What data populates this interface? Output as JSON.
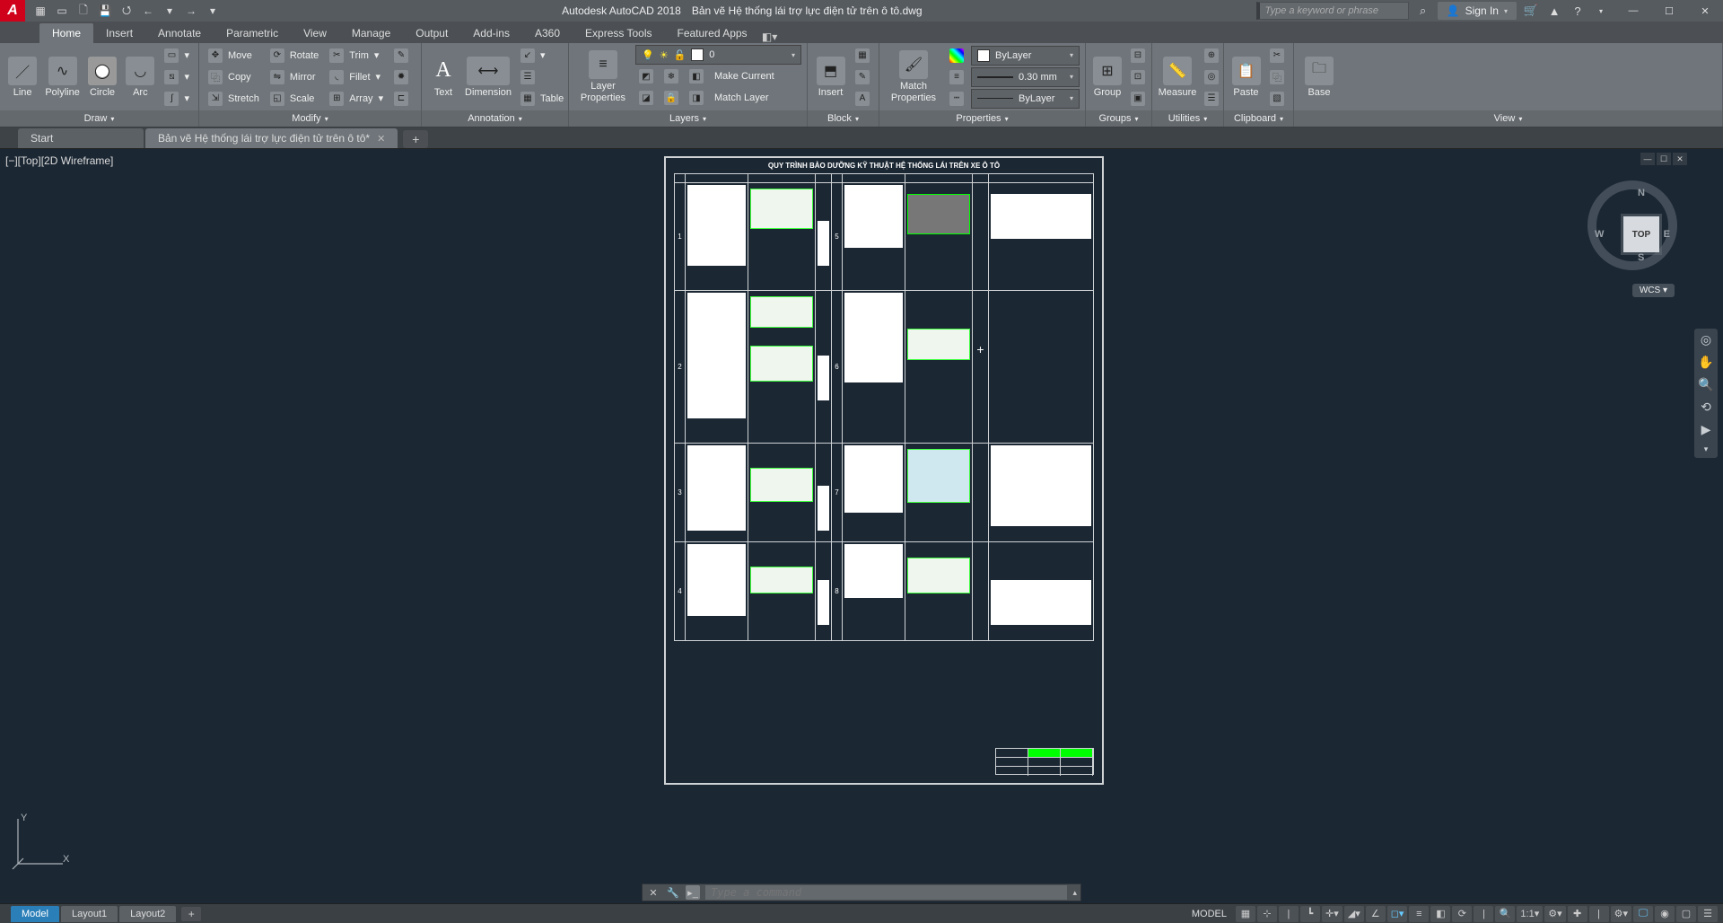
{
  "app": {
    "name": "Autodesk AutoCAD 2018",
    "document": "Bản vẽ Hệ thống lái trợ lực điện tử trên ô tô.dwg",
    "logo": "A",
    "search_placeholder": "Type a keyword or phrase",
    "signin": "Sign In"
  },
  "qat": [
    "▦",
    "▭",
    "🗋",
    "💾",
    "⭯",
    "←",
    "→",
    "▾",
    "▾"
  ],
  "window_controls": {
    "min": "—",
    "max": "☐",
    "close": "✕"
  },
  "ribbon_tabs": [
    "Home",
    "Insert",
    "Annotate",
    "Parametric",
    "View",
    "Manage",
    "Output",
    "Add-ins",
    "A360",
    "Express Tools",
    "Featured Apps"
  ],
  "ribbon_active": 0,
  "ribbon": {
    "draw": {
      "title": "Draw",
      "items": [
        "Line",
        "Polyline",
        "Circle",
        "Arc"
      ]
    },
    "modify": {
      "title": "Modify",
      "items": [
        "Move",
        "Copy",
        "Stretch",
        "Rotate",
        "Mirror",
        "Scale",
        "Trim",
        "Fillet",
        "Array"
      ]
    },
    "annotation": {
      "title": "Annotation",
      "items": [
        "Text",
        "Dimension",
        "Table"
      ]
    },
    "layers": {
      "title": "Layers",
      "props_label": "Layer Properties",
      "current": "0",
      "items": [
        "Make Current",
        "Match Layer"
      ]
    },
    "block": {
      "title": "Block",
      "insert": "Insert"
    },
    "properties": {
      "title": "Properties",
      "match": "Match Properties",
      "color": "ByLayer",
      "lineweight": "0.30 mm",
      "linetype": "ByLayer"
    },
    "groups": {
      "title": "Groups",
      "item": "Group"
    },
    "utilities": {
      "title": "Utilities",
      "item": "Measure"
    },
    "clipboard": {
      "title": "Clipboard",
      "item": "Paste"
    },
    "view": {
      "title": "View",
      "item": "Base"
    }
  },
  "file_tabs": {
    "start": "Start",
    "active": "Bản vẽ Hệ thống lái trợ lực điện tử trên ô tô*"
  },
  "viewport": {
    "label": "[−][Top][2D Wireframe]",
    "cube_top": "TOP",
    "cube_n": "N",
    "cube_s": "S",
    "cube_e": "E",
    "cube_w": "W",
    "wcs": "WCS",
    "ucs_x": "X",
    "ucs_y": "Y"
  },
  "drawing": {
    "title": "QUY TRÌNH BẢO DƯỠNG KỸ THUẬT HỆ THỐNG LÁI TRÊN XE Ô TÔ",
    "rows_left": [
      "1",
      "2",
      "3",
      "4"
    ],
    "rows_right": [
      "5",
      "6",
      "7",
      "8"
    ]
  },
  "cmd": {
    "placeholder": "Type a command"
  },
  "layout_tabs": [
    "Model",
    "Layout1",
    "Layout2"
  ],
  "layout_active": 0,
  "status": {
    "model": "MODEL",
    "scale": "1:1"
  }
}
